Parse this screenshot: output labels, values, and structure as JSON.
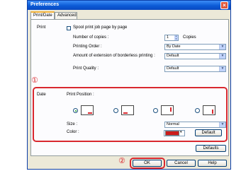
{
  "window": {
    "title": "Preferences"
  },
  "tabs": [
    {
      "label": "Print/Date",
      "active": true
    },
    {
      "label": "Advanced",
      "active": false
    }
  ],
  "print_section": {
    "group_label": "Print",
    "spool_checkbox_label": "Spool print job page by page",
    "spool_checked": false,
    "copies_label": "Number of copies :",
    "copies_value": "1",
    "copies_unit": "Copies",
    "order_label": "Printing Order :",
    "order_value": "By Date",
    "borderless_label": "Amount of extension of borderless printing :",
    "borderless_value": "Default",
    "quality_label": "Print Quality :",
    "quality_value": "Default"
  },
  "date_section": {
    "group_label": "Date",
    "position_label": "Print Position :",
    "positions": [
      "bottom-right-horizontal",
      "bottom-left-horizontal",
      "top-right-vertical",
      "bottom-right-vertical"
    ],
    "selected_position_index": 0,
    "size_label": "Size :",
    "size_value": "Normal",
    "color_label": "Color :",
    "color_value_hex": "#cc1b1b",
    "color_default_button": "Default"
  },
  "defaults_button": "Defaults",
  "buttons": {
    "ok": "OK",
    "cancel": "Cancel",
    "help": "Help"
  },
  "annotations": {
    "marker1": "①",
    "marker2": "②",
    "highlight_color": "#d9282f"
  }
}
